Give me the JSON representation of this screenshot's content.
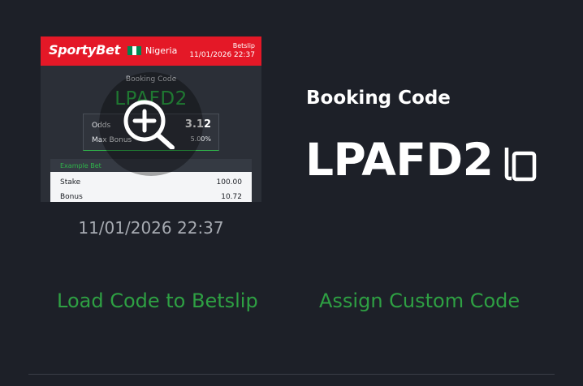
{
  "preview": {
    "brand": "SportyBet",
    "country": "Nigeria",
    "flag_colors": [
      "#008751",
      "#ffffff",
      "#008751"
    ],
    "slip_label": "Betslip",
    "slip_datetime": "11/01/2026 22:37",
    "booking_code_label": "Booking Code",
    "booking_code": "LPAFD2",
    "odds_label": "Odds",
    "odds_value": "3.12",
    "max_bonus_label": "Max Bonus",
    "max_bonus_value": "5.00%",
    "example_bet_label": "Example Bet",
    "stake_label": "Stake",
    "stake_value": "100.00",
    "bonus_label": "Bonus",
    "bonus_value": "10.72",
    "zoom_icon": "zoom-in-icon"
  },
  "preview_datetime": "11/01/2026 22:37",
  "booking": {
    "label": "Booking Code",
    "code": "LPAFD2",
    "copy_icon": "copy-icon"
  },
  "actions": {
    "load_label": "Load Code to Betslip",
    "assign_label": "Assign Custom Code"
  },
  "colors": {
    "background": "#1d2028",
    "brand_red": "#e41827",
    "accent_green": "#2ea043",
    "muted_text": "#a7abb2"
  }
}
